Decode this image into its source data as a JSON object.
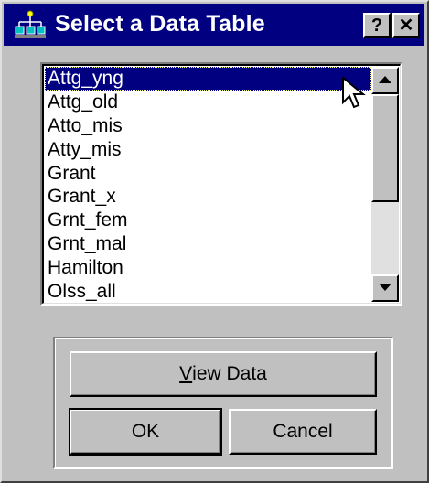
{
  "window": {
    "title": "Select a Data Table",
    "help_label": "?",
    "close_label": "✕",
    "icon": "data-table-icon"
  },
  "table_list": {
    "items": [
      "Attg_yng",
      "Attg_old",
      "Atto_mis",
      "Atty_mis",
      "Grant",
      "Grant_x",
      "Grnt_fem",
      "Grnt_mal",
      "Hamilton",
      "Olss_all"
    ],
    "selected": "Attg_yng"
  },
  "buttons": {
    "view_data_mnemonic": "V",
    "view_data_rest": "iew Data",
    "ok": "OK",
    "cancel": "Cancel"
  },
  "colors": {
    "titlebar": "#000080",
    "face": "#c0c0c0",
    "selection": "#000080"
  }
}
